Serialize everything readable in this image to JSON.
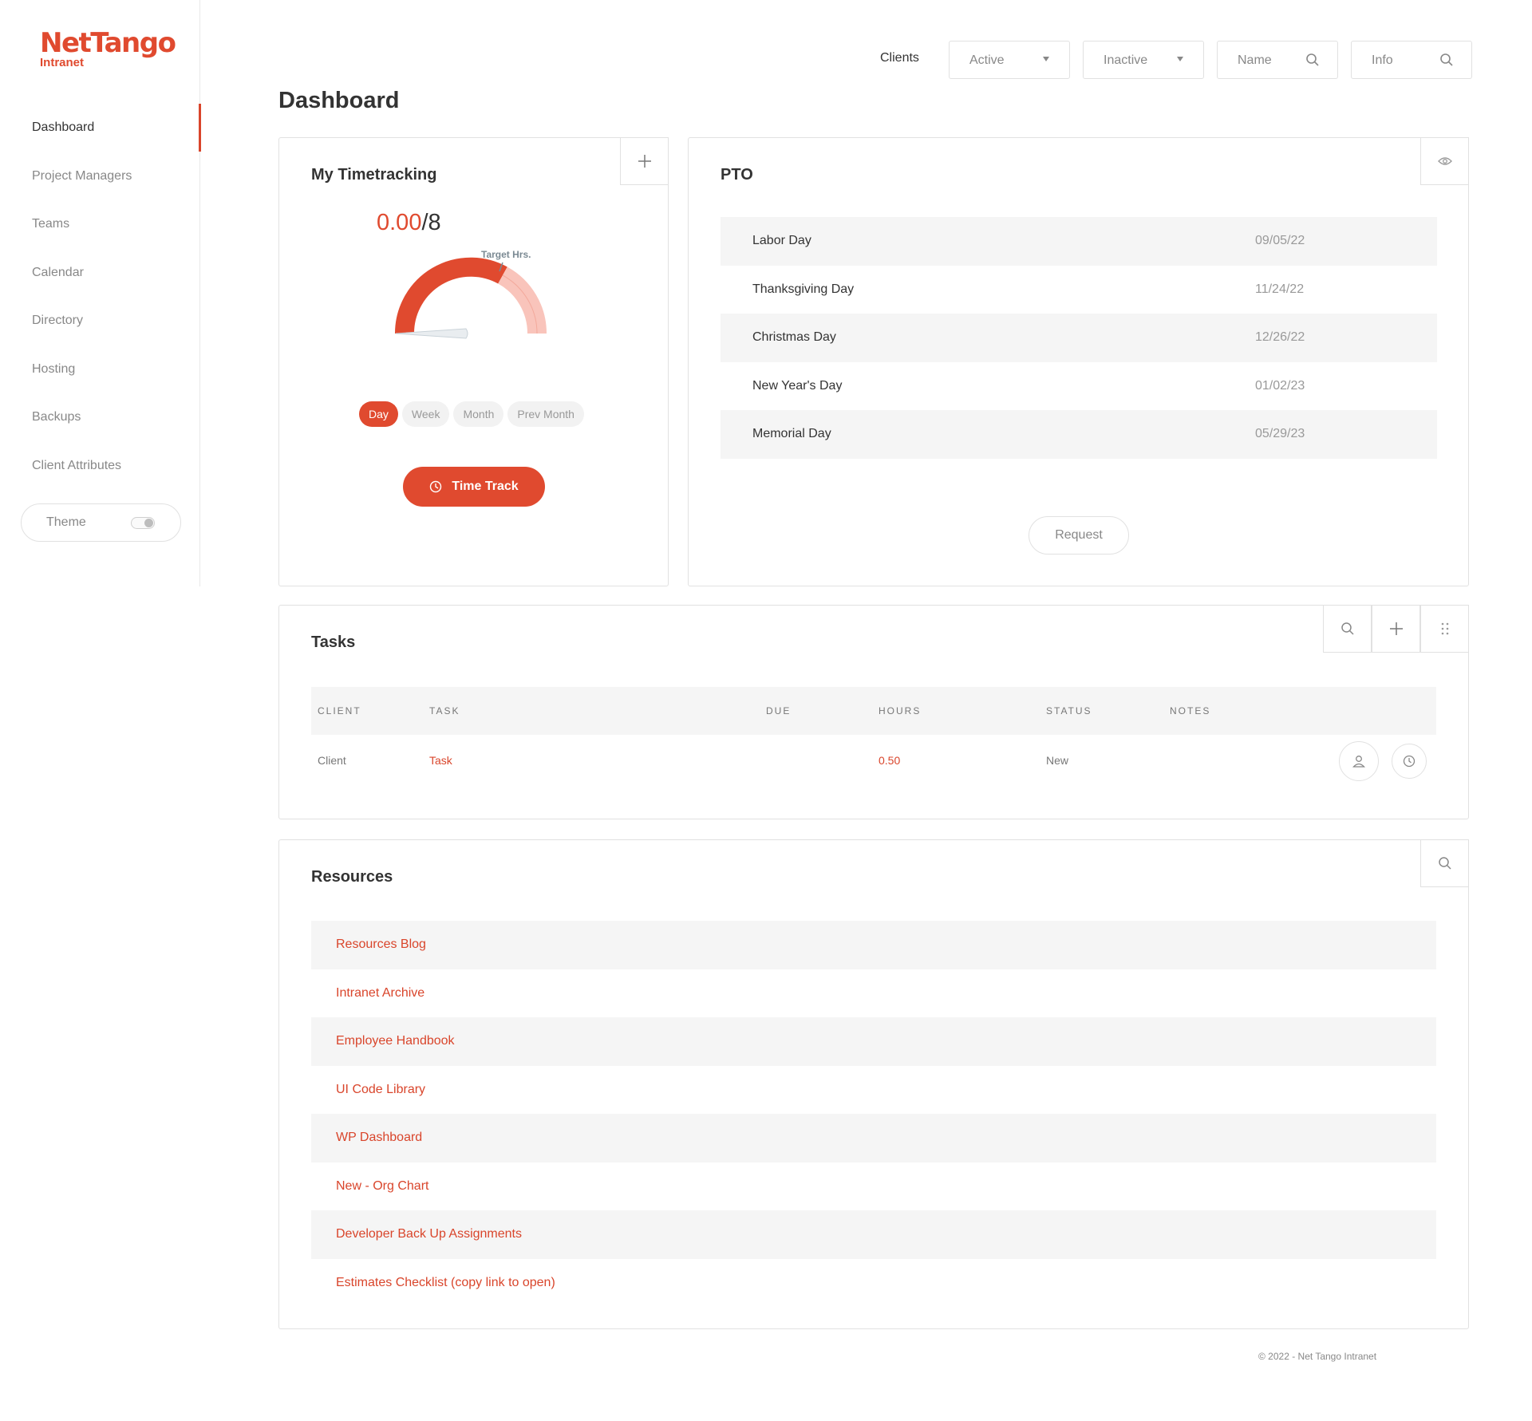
{
  "brand": {
    "name": "NetTango",
    "sub": "Intranet",
    "color": "#e04a2f"
  },
  "sidebar": {
    "items": [
      {
        "label": "Dashboard",
        "active": true
      },
      {
        "label": "Project Managers"
      },
      {
        "label": "Teams"
      },
      {
        "label": "Calendar"
      },
      {
        "label": "Directory"
      },
      {
        "label": "Hosting"
      },
      {
        "label": "Backups"
      },
      {
        "label": "Client Attributes"
      }
    ],
    "theme_label": "Theme"
  },
  "header": {
    "clients_label": "Clients",
    "active_select": "Active",
    "inactive_select": "Inactive",
    "name_search": "Name",
    "info_search": "Info"
  },
  "page_title": "Dashboard",
  "timetracking": {
    "title": "My Timetracking",
    "current": "0.00",
    "target": "/8",
    "target_label": "Target Hrs.",
    "tabs": [
      "Day",
      "Week",
      "Month",
      "Prev Month"
    ],
    "active_tab": "Day",
    "button_label": "Time Track"
  },
  "pto": {
    "title": "PTO",
    "rows": [
      {
        "name": "Labor Day",
        "date": "09/05/22"
      },
      {
        "name": "Thanksgiving Day",
        "date": "11/24/22"
      },
      {
        "name": "Christmas Day",
        "date": "12/26/22"
      },
      {
        "name": "New Year's Day",
        "date": "01/02/23"
      },
      {
        "name": "Memorial Day",
        "date": "05/29/23"
      }
    ],
    "request_label": "Request"
  },
  "tasks": {
    "title": "Tasks",
    "columns": [
      "CLIENT",
      "TASK",
      "DUE",
      "HOURS",
      "STATUS",
      "NOTES"
    ],
    "rows": [
      {
        "client": "Client",
        "task": "Task",
        "due": "",
        "hours": "0.50",
        "status": "New",
        "notes": ""
      }
    ]
  },
  "resources": {
    "title": "Resources",
    "links": [
      "Resources Blog",
      "Intranet Archive",
      "Employee Handbook",
      "UI Code Library",
      "WP Dashboard",
      "New - Org Chart",
      "Developer Back Up Assignments",
      "Estimates Checklist (copy link to open)"
    ]
  },
  "footer": {
    "text": "© 2022 - Net Tango Intranet"
  },
  "colors": {
    "accent": "#e04a2f",
    "accent_light": "#f9c4bb",
    "row_stripe": "#f5f5f5",
    "border": "#e1e1e1"
  }
}
